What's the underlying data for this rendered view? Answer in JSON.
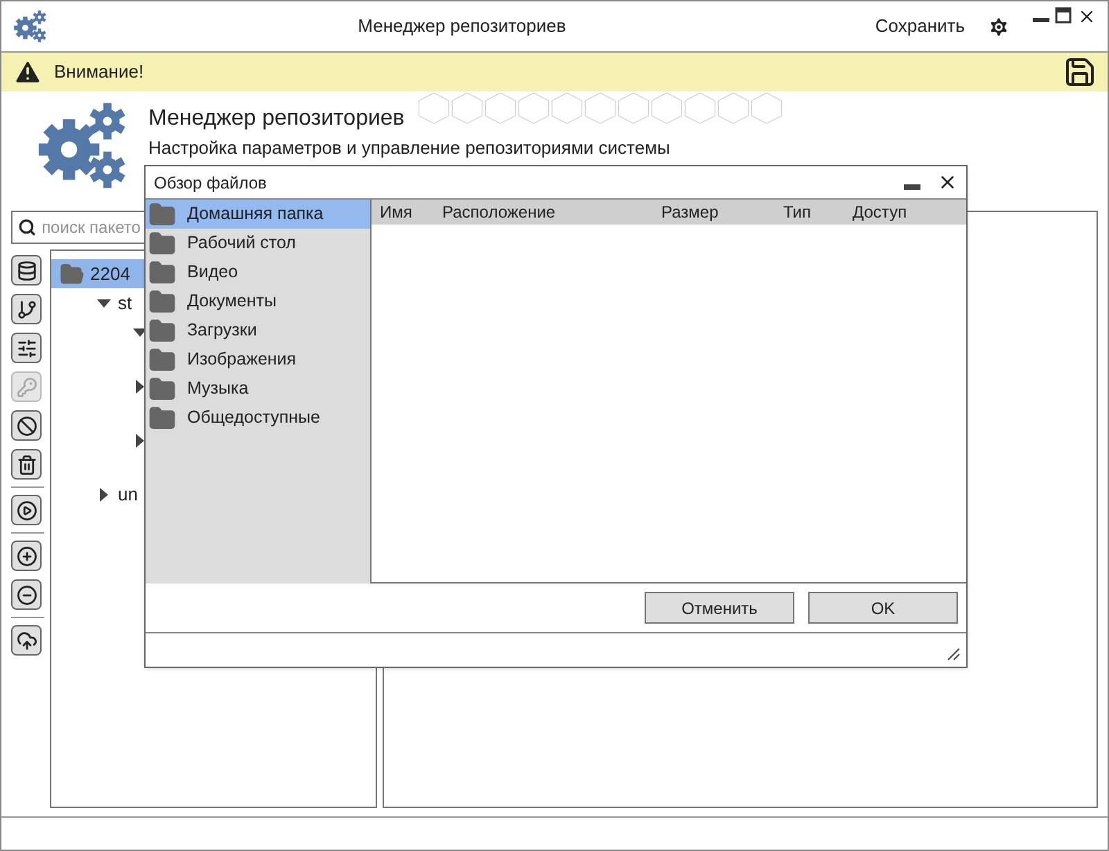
{
  "window": {
    "title": "Менеджер репозиториев",
    "save_label": "Сохранить"
  },
  "warning": {
    "text": "Внимание!"
  },
  "header": {
    "title": "Менеджер репозиториев",
    "subtitle": "Настройка параметров и управление репозиториями системы"
  },
  "search": {
    "placeholder": "поиск пакето"
  },
  "toolbar": [
    {
      "kind": "database",
      "disabled": false
    },
    {
      "kind": "branch",
      "disabled": false
    },
    {
      "kind": "sliders",
      "disabled": false
    },
    {
      "kind": "key",
      "disabled": true
    },
    {
      "kind": "ban",
      "disabled": false
    },
    {
      "kind": "trash",
      "disabled": false
    },
    {
      "kind": "separator"
    },
    {
      "kind": "play",
      "disabled": false
    },
    {
      "kind": "separator"
    },
    {
      "kind": "plus",
      "disabled": false
    },
    {
      "kind": "minus",
      "disabled": false
    },
    {
      "kind": "separator"
    },
    {
      "kind": "upload",
      "disabled": false
    }
  ],
  "tree": [
    {
      "label": "2204",
      "selected": true,
      "expanded": true,
      "children": [
        {
          "label": "st",
          "selected": false,
          "expanded": true,
          "children": [
            {
              "expanded": true
            },
            {
              "expanded": false
            },
            {
              "expanded": false
            }
          ]
        },
        {
          "label": "un",
          "selected": false,
          "expanded": false
        }
      ]
    }
  ],
  "dialog": {
    "title": "Обзор файлов",
    "places": [
      {
        "label": "Домашняя папка",
        "selected": true
      },
      {
        "label": "Рабочий стол",
        "selected": false
      },
      {
        "label": "Видео",
        "selected": false
      },
      {
        "label": "Документы",
        "selected": false
      },
      {
        "label": "Загрузки",
        "selected": false
      },
      {
        "label": "Изображения",
        "selected": false
      },
      {
        "label": "Музыка",
        "selected": false
      },
      {
        "label": "Общедоступные",
        "selected": false
      }
    ],
    "columns": [
      "Имя",
      "Расположение",
      "Размер",
      "Тип",
      "Доступ"
    ],
    "buttons": [
      "Отменить",
      "OK"
    ]
  }
}
